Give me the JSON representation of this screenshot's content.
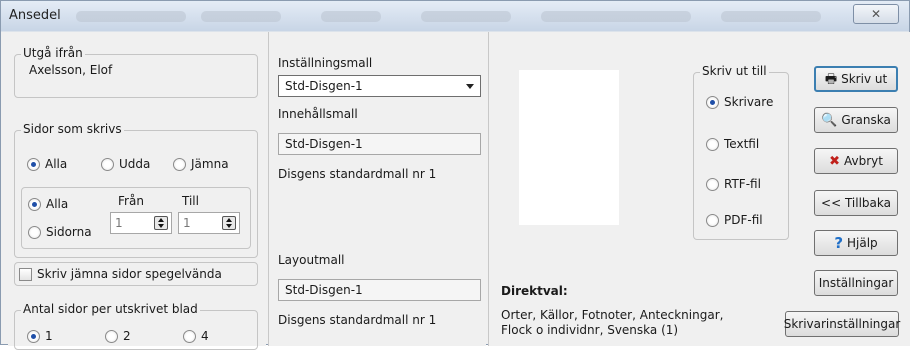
{
  "window": {
    "title": "Ansedel",
    "close_glyph": "✕"
  },
  "utga": {
    "label": "Utgå ifrån",
    "value": "Axelsson, Elof"
  },
  "sidor": {
    "label": "Sidor som skrivs",
    "radios": [
      "Alla",
      "Udda",
      "Jämna"
    ],
    "range_alla": "Alla",
    "range_sidorna": "Sidorna",
    "from_label": "Från",
    "to_label": "Till",
    "from_value": "1",
    "to_value": "1"
  },
  "spegel": {
    "label": "Skriv jämna sidor spegelvända"
  },
  "antal": {
    "label": "Antal sidor per utskrivet blad",
    "options": [
      "1",
      "2",
      "4"
    ]
  },
  "templates": {
    "installning_label": "Inställningsmall",
    "installning_value": "Std-Disgen-1",
    "innehall_label": "Innehållsmall",
    "innehall_value": "Std-Disgen-1",
    "innehall_desc": "Disgens standardmall nr 1",
    "layout_label": "Layoutmall",
    "layout_value": "Std-Disgen-1",
    "layout_desc": "Disgens standardmall nr 1"
  },
  "output": {
    "label": "Skriv ut till",
    "options": [
      "Skrivare",
      "Textfil",
      "RTF-fil",
      "PDF-fil"
    ]
  },
  "direktval": {
    "label": "Direktval:",
    "line1": "Orter, Källor, Fotnoter, Anteckningar,",
    "line2": "Flock o individnr, Svenska (1)"
  },
  "buttons": {
    "print": "Skriv ut",
    "preview": "Granska",
    "cancel": "Avbryt",
    "back": "<< Tillbaka",
    "help": "Hjälp",
    "settings": "Inställningar",
    "printer_settings": "Skrivarinställningar"
  },
  "colors": {
    "accent": "#1f4fa8",
    "cancel_icon": "#c0201a",
    "help_icon": "#1f6fc8"
  }
}
